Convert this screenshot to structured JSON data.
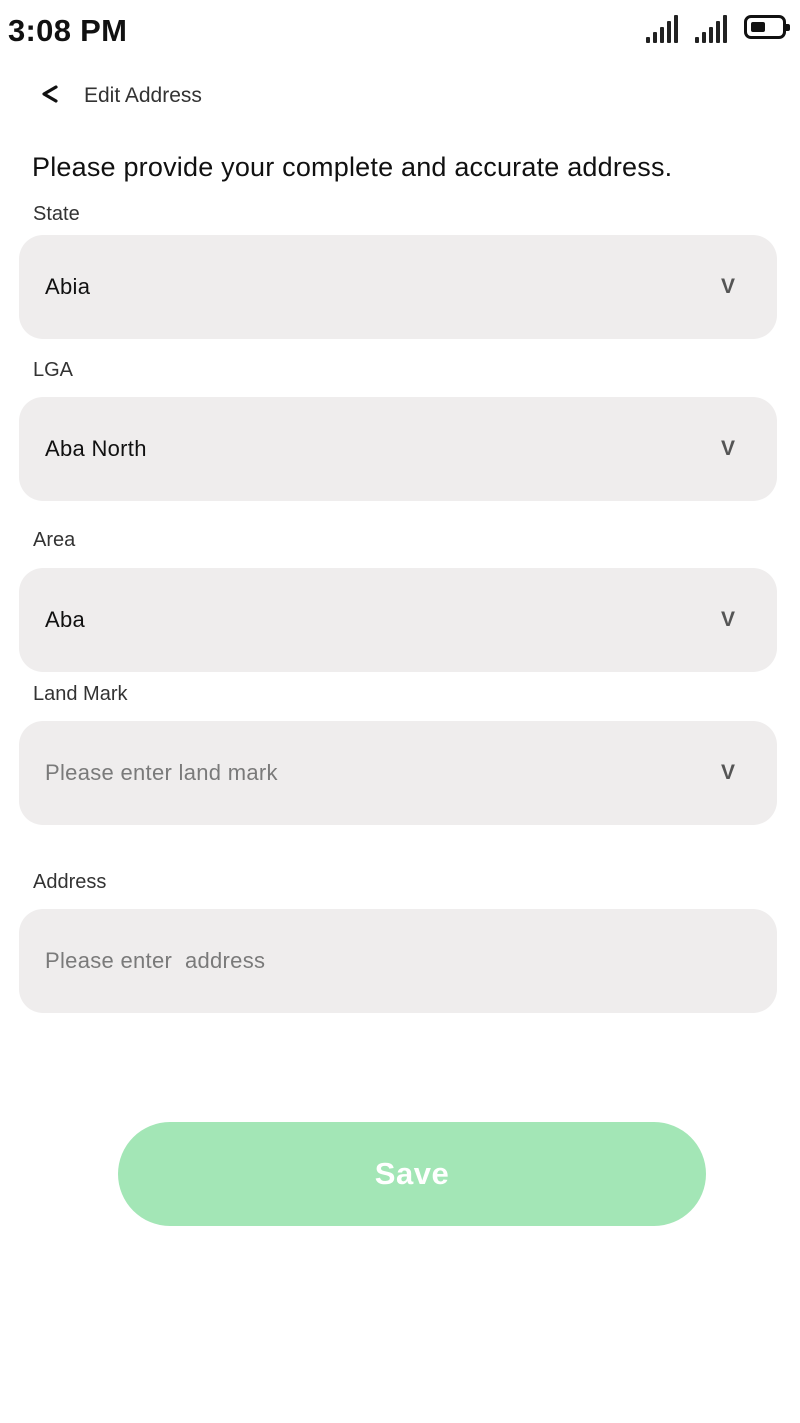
{
  "status_bar": {
    "time": "3:08 PM",
    "icons": [
      "signal-icon",
      "signal-icon",
      "battery-icon"
    ]
  },
  "header": {
    "back_icon": "<",
    "title": "Edit Address"
  },
  "intro_text": "Please provide your complete and accurate address.",
  "form": {
    "state": {
      "label": "State",
      "value": "Abia",
      "chevron": "V"
    },
    "lga": {
      "label": "LGA",
      "value": "Aba North",
      "chevron": "V"
    },
    "area": {
      "label": "Area",
      "value": "Aba",
      "chevron": "V"
    },
    "landmark": {
      "label": "Land Mark",
      "placeholder": "Please enter land mark",
      "chevron": "V"
    },
    "address": {
      "label": "Address",
      "placeholder": "Please enter  address"
    }
  },
  "save_button": {
    "label": "Save",
    "color": "#a3e6b6"
  },
  "colors": {
    "field_background": "#efeded",
    "background": "#ffffff"
  }
}
